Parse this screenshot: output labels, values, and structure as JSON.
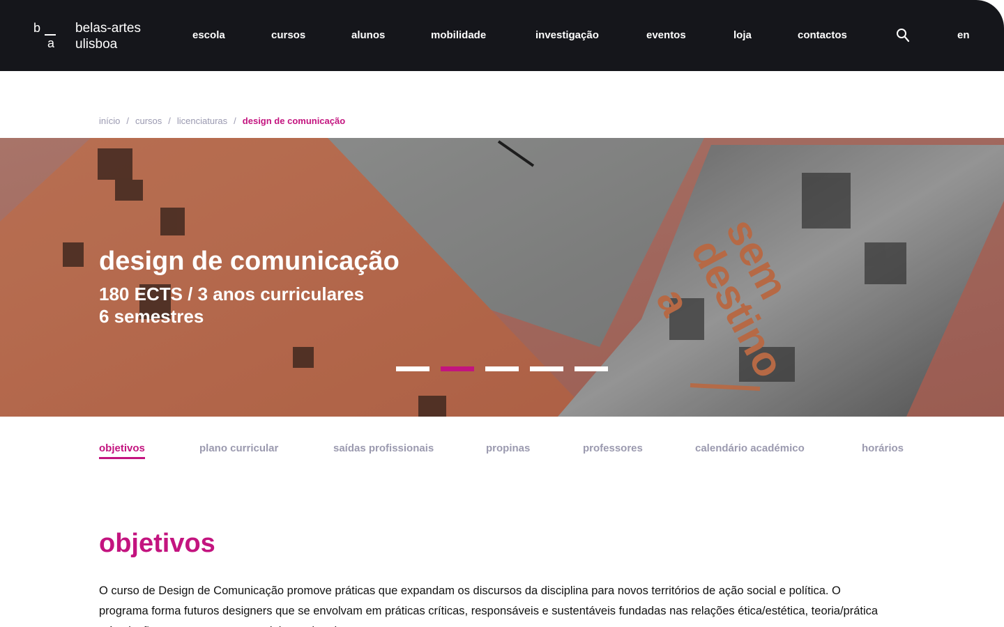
{
  "header": {
    "logo_mark": {
      "top": "b",
      "bottom": "a"
    },
    "logo_line1": "belas-artes",
    "logo_line2": "ulisboa",
    "nav": [
      "escola",
      "cursos",
      "alunos",
      "mobilidade",
      "investigação",
      "eventos",
      "loja",
      "contactos"
    ],
    "search_icon": "search-icon",
    "lang": "en"
  },
  "breadcrumb": {
    "items": [
      "início",
      "cursos",
      "licenciaturas"
    ],
    "separator": "/",
    "current": "design de comunicação"
  },
  "hero": {
    "title": "design de comunicação",
    "subtitle_line1": "180 ECTS / 3 anos curriculares",
    "subtitle_line2": "6 semestres",
    "slides_count": 5,
    "active_slide": 2,
    "artwork_text": [
      "sem",
      "destino",
      "a"
    ]
  },
  "tabs": {
    "items": [
      "objetivos",
      "plano curricular",
      "saídas profissionais",
      "propinas",
      "professores",
      "calendário académico",
      "horários"
    ],
    "active": "objetivos"
  },
  "section": {
    "title": "objetivos",
    "body": "O curso de Design de Comunicação promove práticas que expandam os discursos da disciplina para novos territórios de ação social e política. O programa forma futuros designers que se envolvam em práticas críticas, responsáveis e sustentáveis fundadas nas relações ética/estética, teoria/prática e à relação com os contextos sociais e culturais."
  },
  "colors": {
    "header_bg": "#15161b",
    "accent": "#c3147f",
    "muted": "#9b9aaf"
  }
}
